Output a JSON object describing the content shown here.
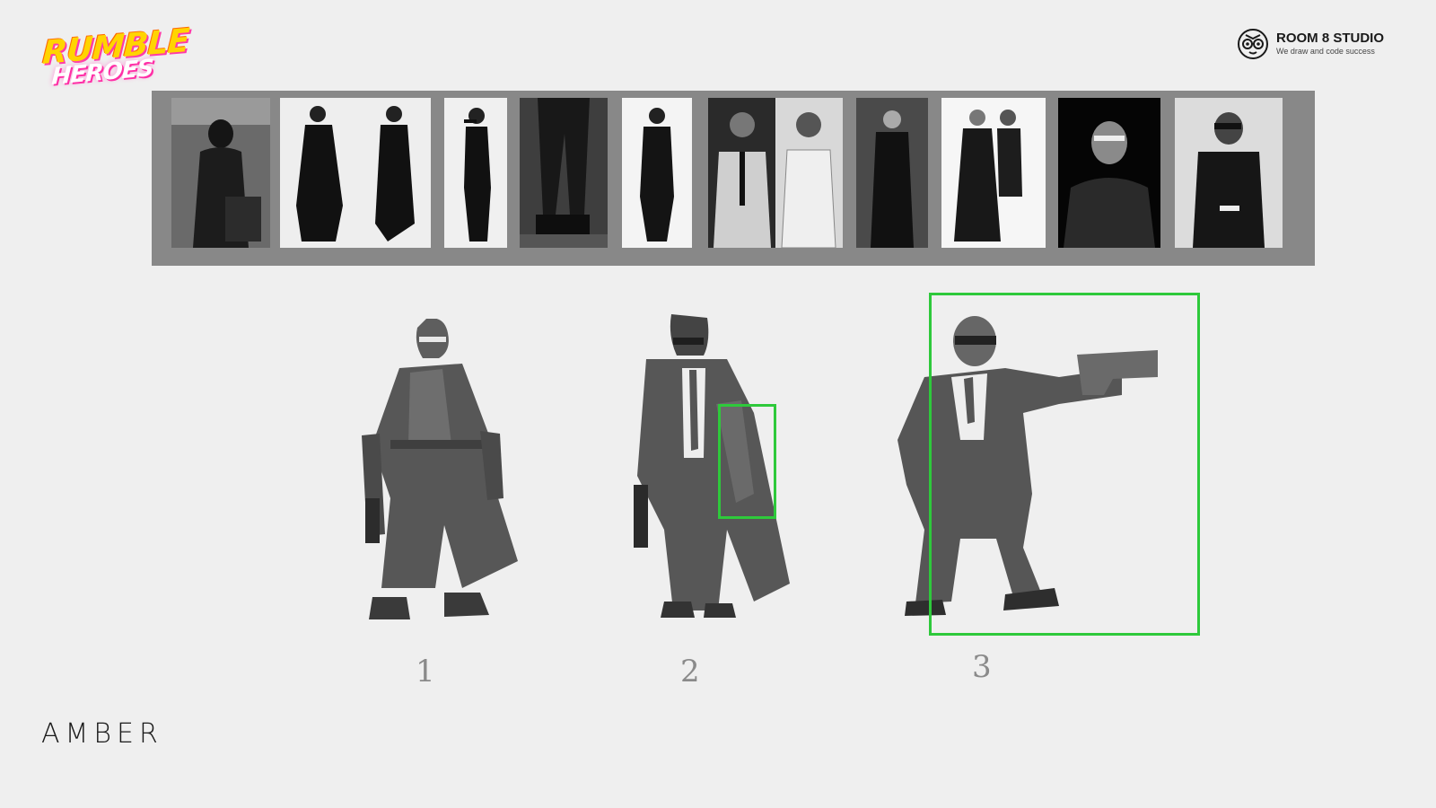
{
  "brand": {
    "game_logo_line1": "RUMBLE",
    "game_logo_line2": "HEROES",
    "studio_name": "ROOM 8 STUDIO",
    "studio_tagline": "We draw and code success",
    "footer_logo": "AMBER"
  },
  "colors": {
    "background": "#efefef",
    "strip": "#888888",
    "highlight": "#2ec93b",
    "sketch": "#5a5a5a"
  },
  "references": {
    "count": 10,
    "description_tags": [
      "helmet-trenchcoat",
      "long-coats-pair",
      "suit-with-pistol",
      "tactical-pants",
      "double-breasted-coat",
      "suits-and-trench-pair",
      "dark-coat",
      "long-coat-pair",
      "turtleneck-visor",
      "visor-jacket"
    ]
  },
  "sketches": [
    {
      "label": "1"
    },
    {
      "label": "2"
    },
    {
      "label": "3"
    }
  ]
}
